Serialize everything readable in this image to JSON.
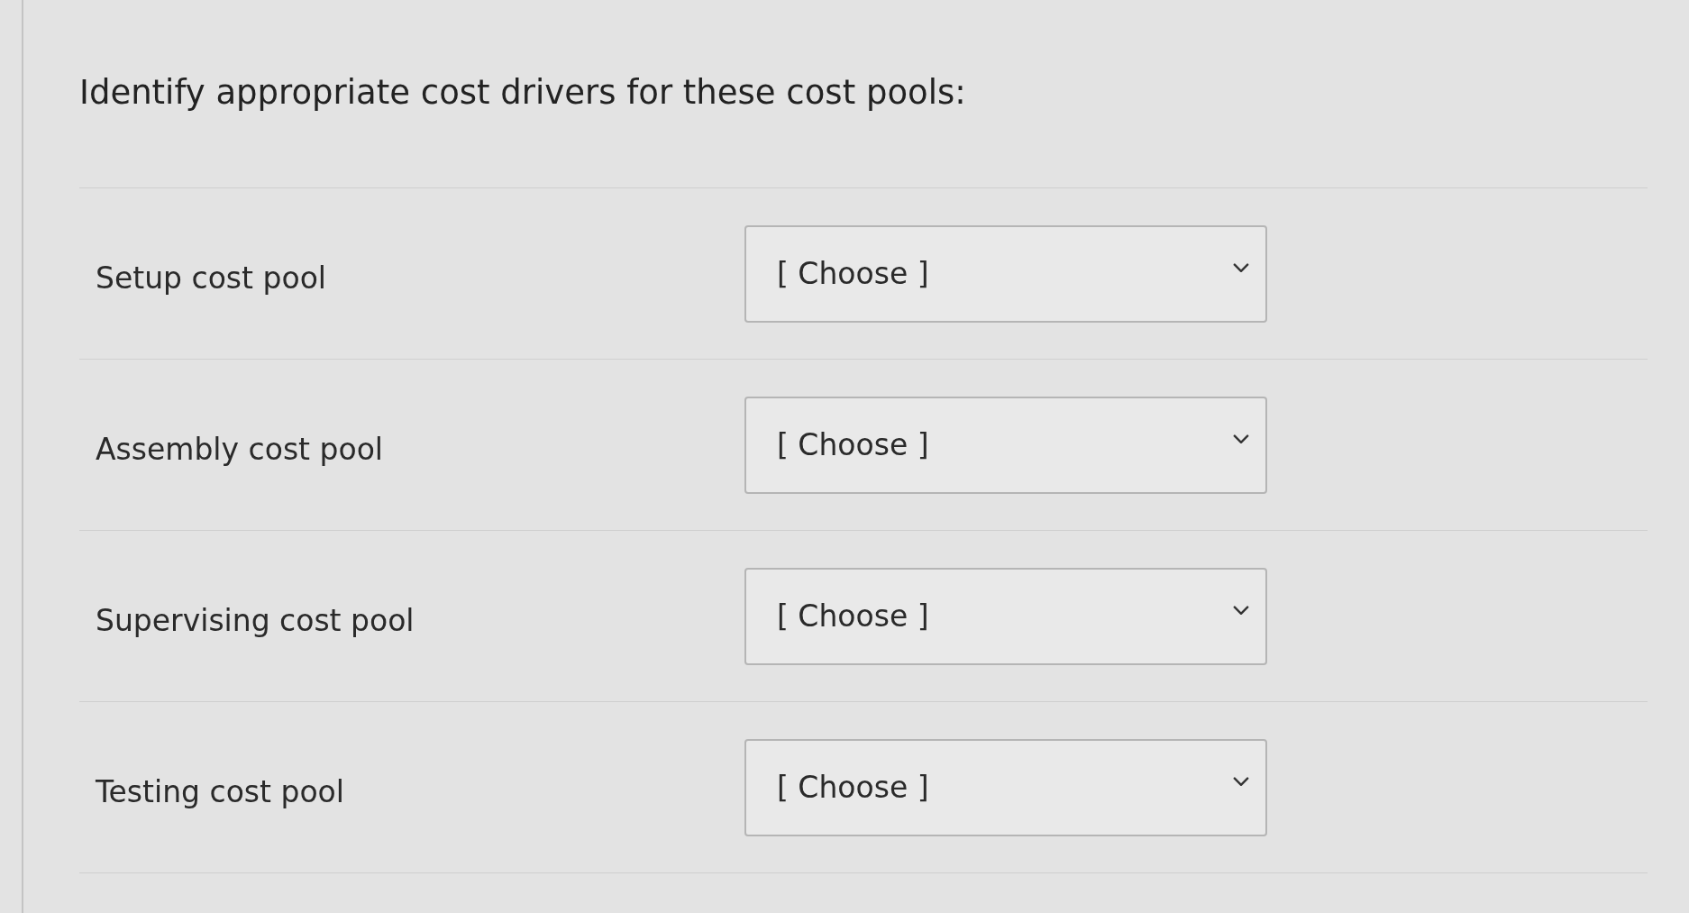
{
  "prompt": "Identify appropriate cost drivers for these cost pools:",
  "rows": [
    {
      "label": "Setup cost pool",
      "dropdown": {
        "value": "[ Choose ]"
      }
    },
    {
      "label": "Assembly cost pool",
      "dropdown": {
        "value": "[ Choose ]"
      }
    },
    {
      "label": "Supervising cost pool",
      "dropdown": {
        "value": "[ Choose ]"
      }
    },
    {
      "label": "Testing cost pool",
      "dropdown": {
        "value": "[ Choose ]"
      }
    }
  ]
}
